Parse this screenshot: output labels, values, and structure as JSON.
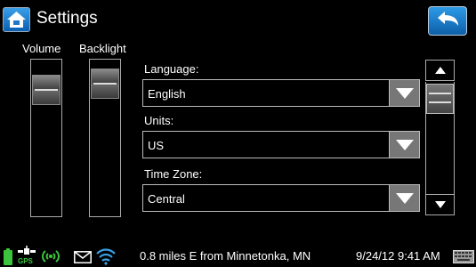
{
  "header": {
    "title": "Settings",
    "home_icon": "home-icon",
    "back_icon": "back-arrow-icon"
  },
  "sliders": {
    "volume": {
      "label": "Volume",
      "level": 0.88
    },
    "backlight": {
      "label": "Backlight",
      "level": 0.93
    }
  },
  "fields": {
    "language": {
      "label": "Language:",
      "value": "English"
    },
    "units": {
      "label": "Units:",
      "value": "US"
    },
    "timezone": {
      "label": "Time Zone:",
      "value": "Central"
    }
  },
  "status_bar": {
    "gps_label": "GPS",
    "location": "0.8 miles E from Minnetonka, MN",
    "datetime": "9/24/12 9:41 AM",
    "icons": [
      "battery-icon",
      "gps-satellite-icon",
      "signal-icon",
      "mail-icon",
      "wifi-icon",
      "keyboard-icon"
    ]
  },
  "colors": {
    "button_blue": "#1f7fd0",
    "battery_green": "#3cc43c",
    "dropdown_arrow_bg": "#777777"
  }
}
